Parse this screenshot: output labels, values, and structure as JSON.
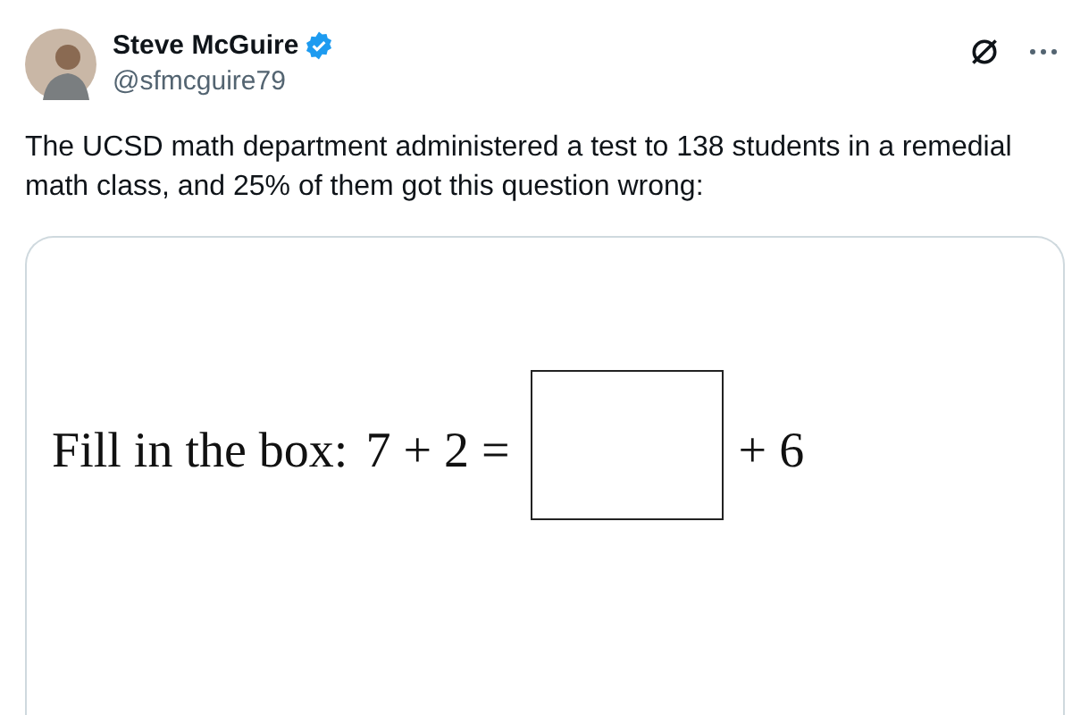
{
  "author": {
    "name": "Steve McGuire",
    "handle": "@sfmcguire79"
  },
  "text": "The UCSD math department administered a test to 138 students in a remedial math class, and 25% of them got this question wrong:",
  "media": {
    "prompt": "Fill in the box:",
    "left": "7 + 2 =",
    "right": "+ 6"
  }
}
